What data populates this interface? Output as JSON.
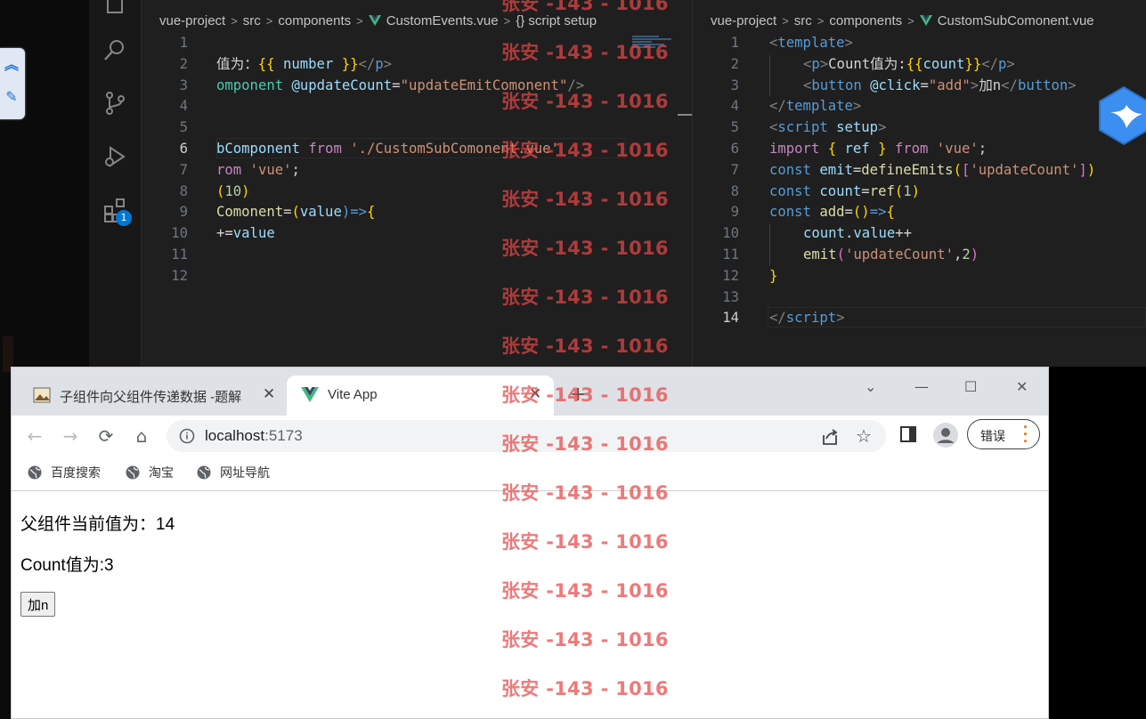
{
  "editor_left": {
    "breadcrumbs": [
      "vue-project",
      "src",
      "components",
      "CustomEvents.vue",
      "{} script setup"
    ],
    "line_numbers": [
      "1",
      "2",
      "3",
      "4",
      "5",
      "6",
      "7",
      "8",
      "9",
      "10",
      "11",
      "12"
    ],
    "active_line": "6",
    "code": {
      "l2_a": "值为：",
      "l2_b": "{{",
      "l2_c": " number ",
      "l2_d": "}}",
      "l2_e": "</",
      "l2_f": "p",
      "l2_g": ">",
      "l3_a": "omponent",
      "l3_b": " @updateCount",
      "l3_c": "=",
      "l3_d": "\"updateEmitComonent\"",
      "l3_e": "/>",
      "l6_a": "bComponent",
      "l6_b": " from ",
      "l6_c": "'./CustomSubComonent.vue'",
      "l7_a": "rom ",
      "l7_b": "'vue'",
      "l7_c": ";",
      "l8_a": "(",
      "l8_b": "10",
      "l8_c": ")",
      "l9_a": "Comonent",
      "l9_b": "=",
      "l9_c": "(",
      "l9_d": "value",
      "l9_e": ")=>",
      "l9_f": "{",
      "l10_a": "+=",
      "l10_b": "value"
    }
  },
  "editor_right": {
    "breadcrumbs": [
      "vue-project",
      "src",
      "components",
      "CustomSubComonent.vue"
    ],
    "line_numbers": [
      "1",
      "2",
      "3",
      "4",
      "5",
      "6",
      "7",
      "8",
      "9",
      "10",
      "11",
      "12",
      "13",
      "14"
    ],
    "active_line": "14",
    "code": {
      "l1_a": "<",
      "l1_b": "template",
      "l1_c": ">",
      "l2_a": "<",
      "l2_b": "p",
      "l2_c": ">",
      "l2_d": "Count值为:",
      "l2_e": "{{",
      "l2_f": "count",
      "l2_g": "}}",
      "l2_h": "</",
      "l2_i": "p",
      "l2_j": ">",
      "l3_a": "<",
      "l3_b": "button",
      "l3_c": " @click",
      "l3_d": "=",
      "l3_e": "\"add\"",
      "l3_f": ">",
      "l3_g": "加n",
      "l3_h": "</",
      "l3_i": "button",
      "l3_j": ">",
      "l4_a": "</",
      "l4_b": "template",
      "l4_c": ">",
      "l5_a": "<",
      "l5_b": "script",
      "l5_c": " setup",
      "l5_d": ">",
      "l6_a": "import",
      "l6_b": " { ",
      "l6_c": "ref",
      "l6_d": " } ",
      "l6_e": "from",
      "l6_f": " 'vue'",
      "l6_g": ";",
      "l7_a": "const",
      "l7_b": " emit",
      "l7_c": "=",
      "l7_d": "defineEmits",
      "l7_e": "(",
      "l7_f": "[",
      "l7_g": "'updateCount'",
      "l7_h": "]",
      "l7_i": ")",
      "l8_a": "const",
      "l8_b": " count",
      "l8_c": "=",
      "l8_d": "ref",
      "l8_e": "(",
      "l8_f": "1",
      "l8_g": ")",
      "l9_a": "const",
      "l9_b": " add",
      "l9_c": "=",
      "l9_d": "()",
      "l9_e": "=>",
      "l9_f": "{",
      "l10_a": "count",
      "l10_b": ".",
      "l10_c": "value",
      "l10_d": "++",
      "l11_a": "emit",
      "l11_b": "(",
      "l11_c": "'updateCount'",
      "l11_d": ",",
      "l11_e": "2",
      "l11_f": ")",
      "l12_a": "}",
      "l14_a": "</",
      "l14_b": "script",
      "l14_c": ">"
    }
  },
  "activity_bar": {
    "icons": [
      "explorer-icon",
      "search-icon",
      "source-control-icon",
      "run-debug-icon",
      "extensions-icon"
    ],
    "extensions_badge": "1"
  },
  "browser": {
    "tabs": [
      {
        "title": "子组件向父组件传递数据 -题解",
        "close": "✕"
      },
      {
        "title": "Vite App",
        "close": "✕"
      }
    ],
    "new_tab": "+",
    "window_controls": [
      "⌄",
      "—",
      "☐",
      "✕"
    ],
    "url_host": "localhost",
    "url_port": ":5173",
    "error_chip": "错误",
    "bookmarks": [
      "百度搜索",
      "淘宝",
      "网址导航"
    ],
    "page": {
      "parent_text": "父组件当前值为：14",
      "count_text": "Count值为:3",
      "button_label": "加n"
    }
  },
  "watermark": {
    "text": "张安 -143 - 1016",
    "repeat_count": 15
  },
  "colors": {
    "editor_bg": "#1f1f1f",
    "watermark": "#e64646",
    "vue_green": "#42b883",
    "badge_blue": "#0078d4"
  }
}
